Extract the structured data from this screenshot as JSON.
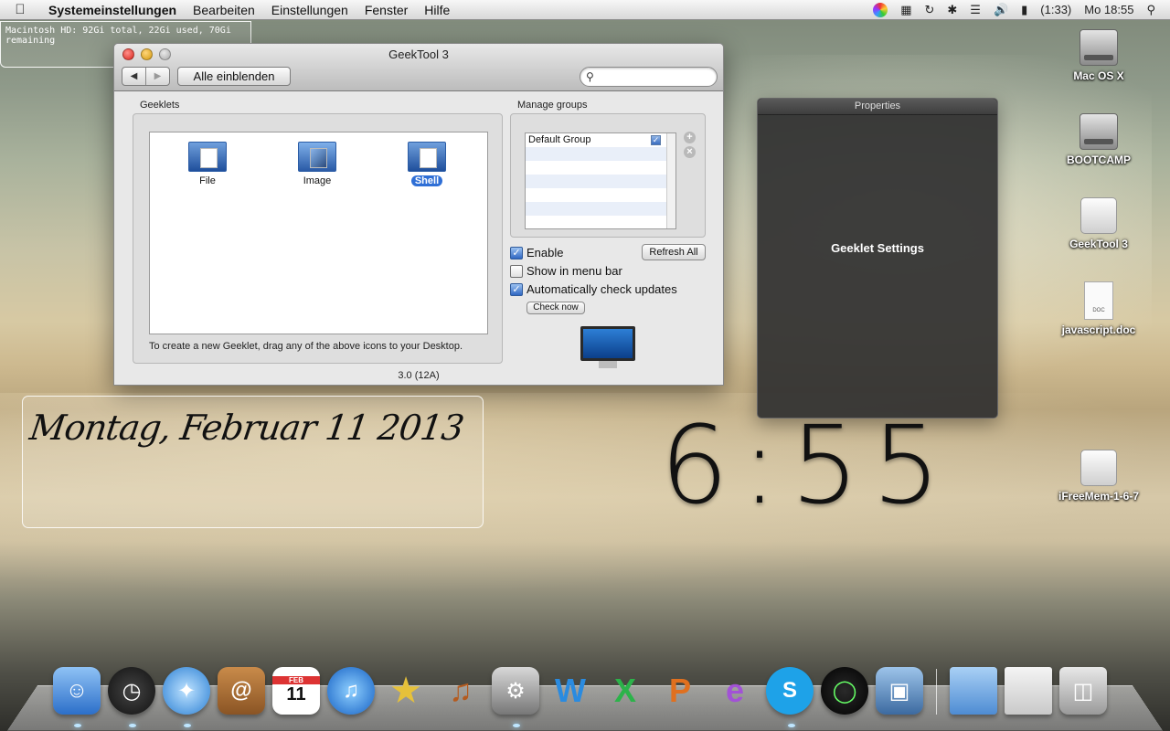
{
  "menubar": {
    "app": "Systemeinstellungen",
    "items": [
      "Bearbeiten",
      "Einstellungen",
      "Fenster",
      "Hilfe"
    ],
    "battery": "(1:33)",
    "clock": "Mo 18:55",
    "status_icons": [
      "color-picker-icon",
      "grid-icon",
      "time-machine-icon",
      "bluetooth-icon",
      "wifi-icon",
      "volume-icon",
      "battery-icon",
      "spotlight-icon"
    ]
  },
  "disk_geeklet": {
    "text": "Macintosh HD: 92Gi total, 22Gi used, 70Gi remaining"
  },
  "window": {
    "title": "GeekTool 3",
    "show_all": "Alle einblenden",
    "search_placeholder": "",
    "geeklets_label": "Geeklets",
    "geeklets": [
      {
        "label": "File",
        "icon": "file-geeklet-icon",
        "selected": false
      },
      {
        "label": "Image",
        "icon": "image-geeklet-icon",
        "selected": false
      },
      {
        "label": "Shell",
        "icon": "shell-geeklet-icon",
        "selected": true
      }
    ],
    "hint": "To create a new Geeklet, drag any of the above icons to your Desktop.",
    "groups_label": "Manage groups",
    "groups": [
      {
        "name": "Default Group",
        "checked": true
      }
    ],
    "enable": "Enable",
    "refresh_all": "Refresh All",
    "show_menu_bar": "Show in menu bar",
    "auto_check": "Automatically check updates",
    "check_now": "Check now",
    "version": "3.0 (12A)"
  },
  "properties": {
    "title": "Properties",
    "body": "Geeklet Settings"
  },
  "date_geeklet": {
    "text": "Montag, Februar 11 2013"
  },
  "clock_geeklet": {
    "text": "6:55"
  },
  "desktop_icons": [
    {
      "label": "Mac OS X",
      "kind": "hard-drive-icon"
    },
    {
      "label": "BOOTCAMP",
      "kind": "hard-drive-icon"
    },
    {
      "label": "GeekTool 3",
      "kind": "disk-image-icon"
    },
    {
      "label": "javascript.doc",
      "kind": "document-icon",
      "badge": "DOC"
    },
    {
      "label": "iFreeMem-1-6-7",
      "kind": "disk-image-icon"
    }
  ],
  "dock": {
    "feb_label": "FEB",
    "day": "11",
    "apps": [
      "finder",
      "dashboard",
      "safari",
      "address-book",
      "ical",
      "itunes",
      "imovie",
      "garageband",
      "system-preferences",
      "word",
      "excel",
      "powerpoint",
      "entourage",
      "skype",
      "activity-monitor",
      "iphoto",
      "documents-folder",
      "downloads-stack",
      "trash"
    ]
  }
}
